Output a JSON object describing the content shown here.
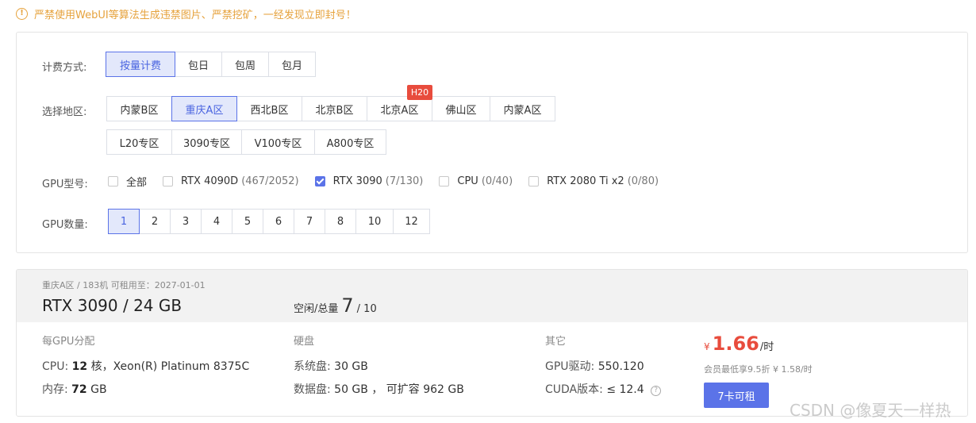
{
  "warning": {
    "icon": "!",
    "text": "严禁使用WebUI等算法生成违禁图片、严禁挖矿，一经发现立即封号！"
  },
  "billing": {
    "label": "计费方式:",
    "options": [
      "按量计费",
      "包日",
      "包周",
      "包月"
    ],
    "selected": "按量计费"
  },
  "region": {
    "label": "选择地区:",
    "row1": [
      "内蒙B区",
      "重庆A区",
      "西北B区",
      "北京B区",
      "北京A区",
      "佛山区",
      "内蒙A区"
    ],
    "row2": [
      "L20专区",
      "3090专区",
      "V100专区",
      "A800专区"
    ],
    "selected": "重庆A区",
    "badge": "H20"
  },
  "gpu_model": {
    "label": "GPU型号:",
    "options": [
      {
        "name": "全部",
        "count": "",
        "checked": false
      },
      {
        "name": "RTX 4090D",
        "count": "(467/2052)",
        "checked": false
      },
      {
        "name": "RTX 3090",
        "count": "(7/130)",
        "checked": true
      },
      {
        "name": "CPU",
        "count": "(0/40)",
        "checked": false
      },
      {
        "name": "RTX 2080 Ti x2",
        "count": "(0/80)",
        "checked": false
      }
    ]
  },
  "gpu_count": {
    "label": "GPU数量:",
    "options": [
      "1",
      "2",
      "3",
      "4",
      "5",
      "6",
      "7",
      "8",
      "10",
      "12"
    ],
    "selected": "1"
  },
  "machine": {
    "sub_info": "重庆A区 / 183机   可租用至：2027-01-01",
    "title": "RTX 3090 / 24 GB",
    "idle_label": "空闲/总量",
    "idle": "7",
    "total": "/ 10",
    "per_gpu": {
      "heading": "每GPU分配",
      "cpu_label": "CPU:",
      "cpu_cores": "12",
      "cpu_rest": "核，Xeon(R) Platinum 8375C",
      "mem_label": "内存:",
      "mem_value": "72",
      "mem_unit": "GB"
    },
    "disk": {
      "heading": "硬盘",
      "sys_label": "系统盘:",
      "sys_value": "30 GB",
      "data_label": "数据盘:",
      "data_value": "50 GB ， 可扩容 962 GB"
    },
    "other": {
      "heading": "其它",
      "driver_label": "GPU驱动:",
      "driver_value": "550.120",
      "cuda_label": "CUDA版本:",
      "cuda_value": "≤ 12.4",
      "help_glyph": "?"
    },
    "price": {
      "currency": "¥",
      "amount": "1.66",
      "unit": "/时",
      "member_note": "会员最低享9.5折 ¥ 1.58/时"
    },
    "rent_button": "7卡可租"
  },
  "watermark": "CSDN @像夏天一样热",
  "colors": {
    "accent": "#5b73e8",
    "warning": "#e6a23c",
    "price": "#e84c3d",
    "badge": "#e84c3d"
  }
}
